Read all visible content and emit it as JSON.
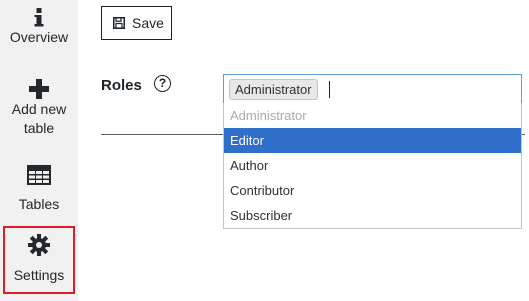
{
  "sidebar": {
    "items": [
      {
        "label": "Overview",
        "icon": "info-icon"
      },
      {
        "label": "Add new\ntable",
        "icon": "plus-icon"
      },
      {
        "label": "Tables",
        "icon": "table-icon"
      },
      {
        "label": "Settings",
        "icon": "gear-icon",
        "active": true
      }
    ]
  },
  "toolbar": {
    "save_label": "Save",
    "save_icon": "floppy-disk-icon"
  },
  "roles": {
    "label": "Roles",
    "help_icon": "?",
    "selected_tag": "Administrator",
    "options": [
      {
        "label": "Administrator",
        "state": "disabled"
      },
      {
        "label": "Editor",
        "state": "highlighted"
      },
      {
        "label": "Author",
        "state": "normal"
      },
      {
        "label": "Contributor",
        "state": "normal"
      },
      {
        "label": "Subscriber",
        "state": "normal"
      }
    ]
  },
  "colors": {
    "highlight": "#2f6fca",
    "active_outline": "#e01b2b",
    "focus_border": "#5b9dd9",
    "sidebar_bg": "#f1f1f1"
  }
}
